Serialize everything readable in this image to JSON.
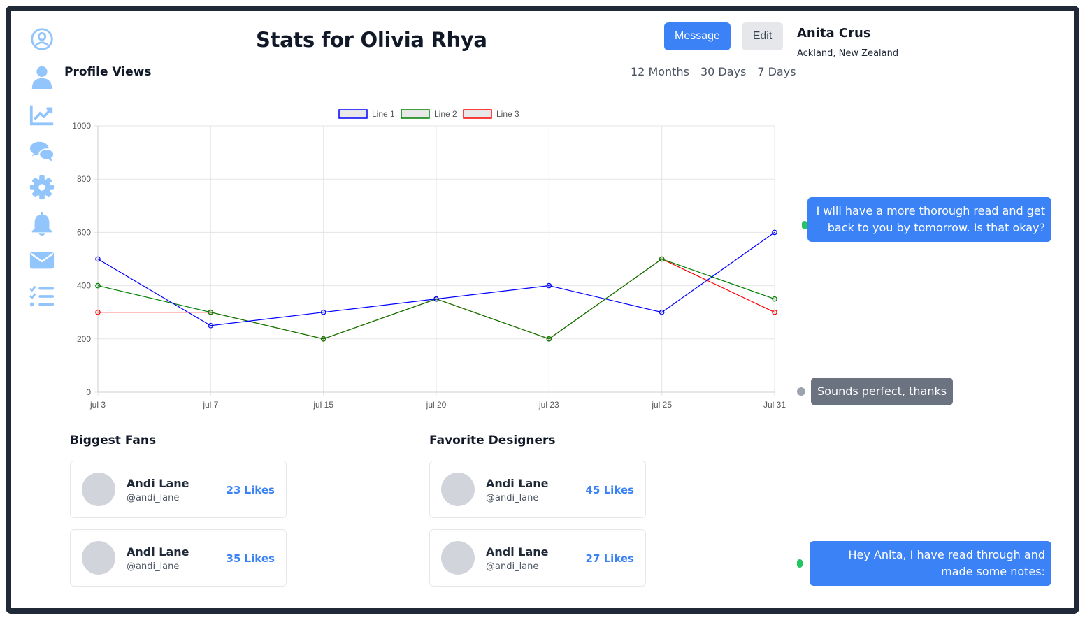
{
  "page_title": "Stats for Olivia Rhya",
  "actions": {
    "message_label": "Message",
    "edit_label": "Edit"
  },
  "sidebar": {
    "items": [
      {
        "icon": "user-circle-icon"
      },
      {
        "icon": "user-icon"
      },
      {
        "icon": "chart-line-icon"
      },
      {
        "icon": "comments-icon"
      },
      {
        "icon": "gear-icon"
      },
      {
        "icon": "bell-icon"
      },
      {
        "icon": "envelope-icon"
      },
      {
        "icon": "list-check-icon"
      }
    ],
    "color": "#93c5fd"
  },
  "profile_views": {
    "title": "Profile Views",
    "ranges": [
      "12 Months",
      "30 Days",
      "7 Days"
    ]
  },
  "chart_data": {
    "type": "line",
    "categories": [
      "jul 3",
      "jul 7",
      "jul 15",
      "jul 20",
      "jul 23",
      "jul 25",
      "Jul 31"
    ],
    "ylim": [
      0,
      1000
    ],
    "yticks": [
      0,
      200,
      400,
      600,
      800,
      1000
    ],
    "grid": true,
    "legend": "top-center",
    "series": [
      {
        "name": "Line 1",
        "color": "#0000ff",
        "values": [
          500,
          250,
          300,
          350,
          400,
          300,
          600
        ]
      },
      {
        "name": "Line 2",
        "color": "#008000",
        "values": [
          400,
          300,
          200,
          350,
          200,
          500,
          350
        ]
      },
      {
        "name": "Line 3",
        "color": "#ff0000",
        "values": [
          300,
          300,
          200,
          350,
          200,
          500,
          300
        ]
      }
    ]
  },
  "biggest_fans": {
    "title": "Biggest Fans",
    "items": [
      {
        "name": "Andi Lane",
        "handle": "@andi_lane",
        "likes": "23 Likes"
      },
      {
        "name": "Andi Lane",
        "handle": "@andi_lane",
        "likes": "35 Likes"
      }
    ]
  },
  "favorite_designers": {
    "title": "Favorite Designers",
    "items": [
      {
        "name": "Andi Lane",
        "handle": "@andi_lane",
        "likes": "45 Likes"
      },
      {
        "name": "Andi Lane",
        "handle": "@andi_lane",
        "likes": "27 Likes"
      }
    ]
  },
  "contact": {
    "name": "Anita Crus",
    "location": "Ackland, New Zealand"
  },
  "messages": [
    {
      "text": "I will have a more thorough read and get back to you by tomorrow. Is that okay?",
      "status": "online"
    },
    {
      "text": "Sounds perfect, thanks",
      "status": "offline"
    },
    {
      "text": "Hey Anita, I have read through and made some notes:",
      "status": "online"
    }
  ]
}
